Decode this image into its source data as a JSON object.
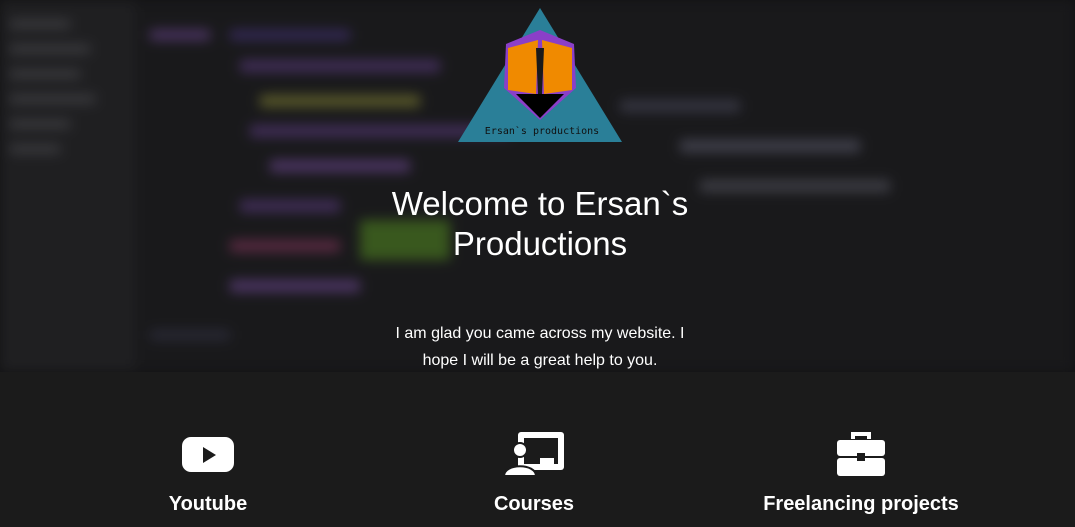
{
  "hero": {
    "logo_text": "Ersan`s productions",
    "title": "Welcome to Ersan`s Productions",
    "subtitle": "I am glad you came across my website. I hope I will be a great help to you."
  },
  "services": [
    {
      "label": "Youtube",
      "icon": "youtube-icon"
    },
    {
      "label": "Courses",
      "icon": "teacher-board-icon"
    },
    {
      "label": "Freelancing projects",
      "icon": "briefcase-icon"
    }
  ],
  "colors": {
    "background": "#1b1b1b",
    "text": "#ffffff",
    "logo_triangle": "#2a7f98",
    "logo_orange": "#f08a00",
    "logo_purple": "#8b3fc8"
  }
}
